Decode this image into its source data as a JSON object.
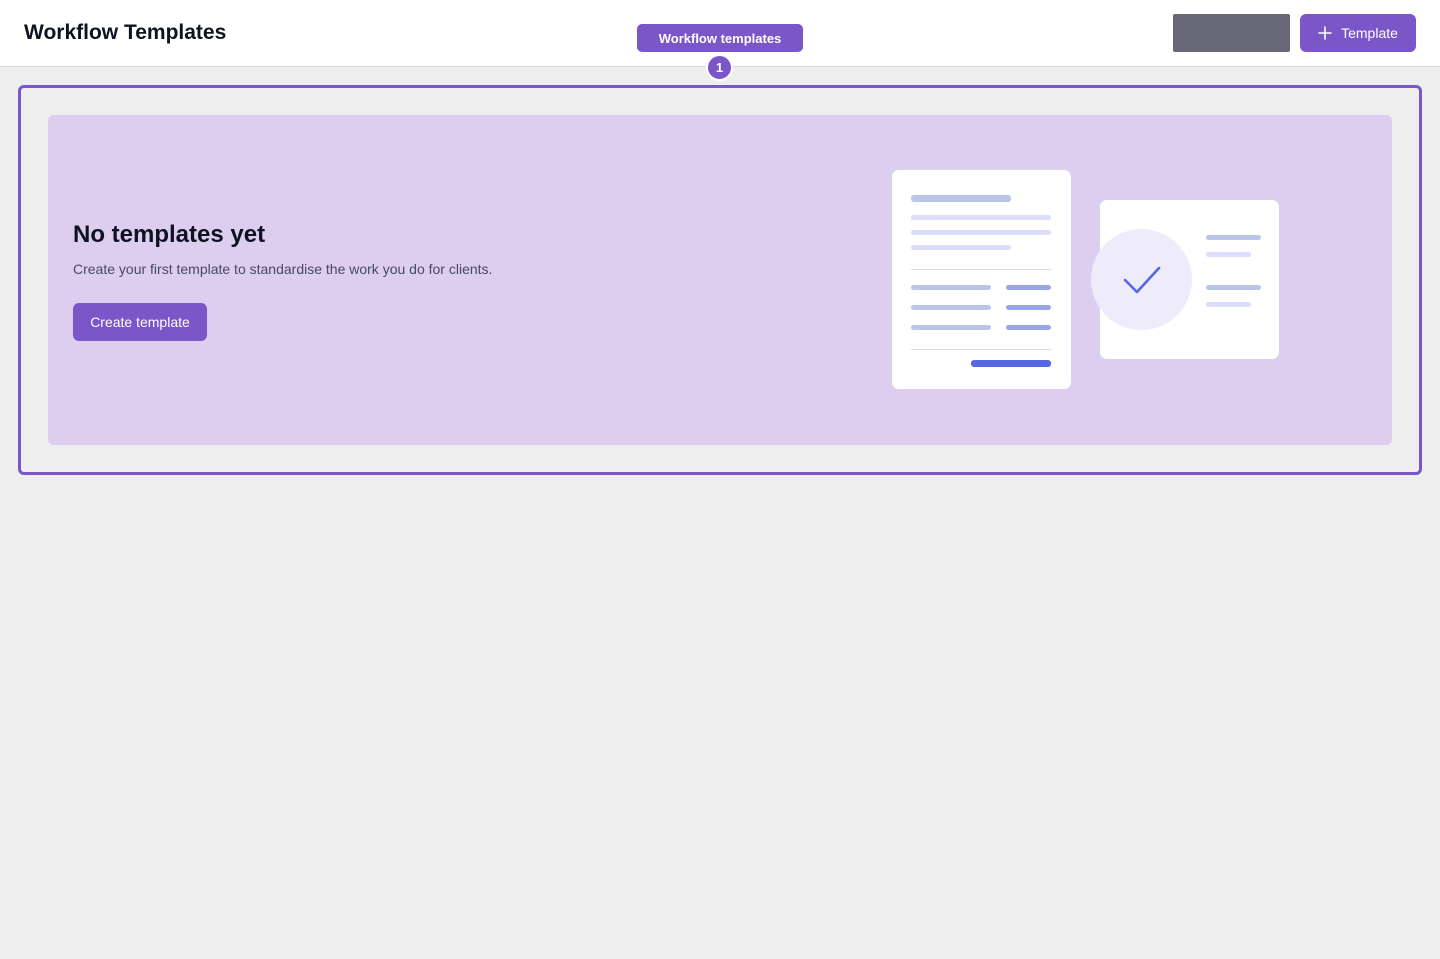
{
  "header": {
    "title": "Workflow Templates",
    "add_button_label": "Template"
  },
  "tour": {
    "label": "Workflow templates",
    "step": "1"
  },
  "empty_state": {
    "title": "No templates yet",
    "description": "Create your first template to standardise the work you do for clients.",
    "button_label": "Create template"
  },
  "icons": {
    "add": "plus-icon",
    "illustration": "check-icon"
  },
  "colors": {
    "accent": "#7b56c9",
    "card_background": "#ddcdef",
    "page_background": "#eeeeee",
    "placeholder": "#676775"
  }
}
